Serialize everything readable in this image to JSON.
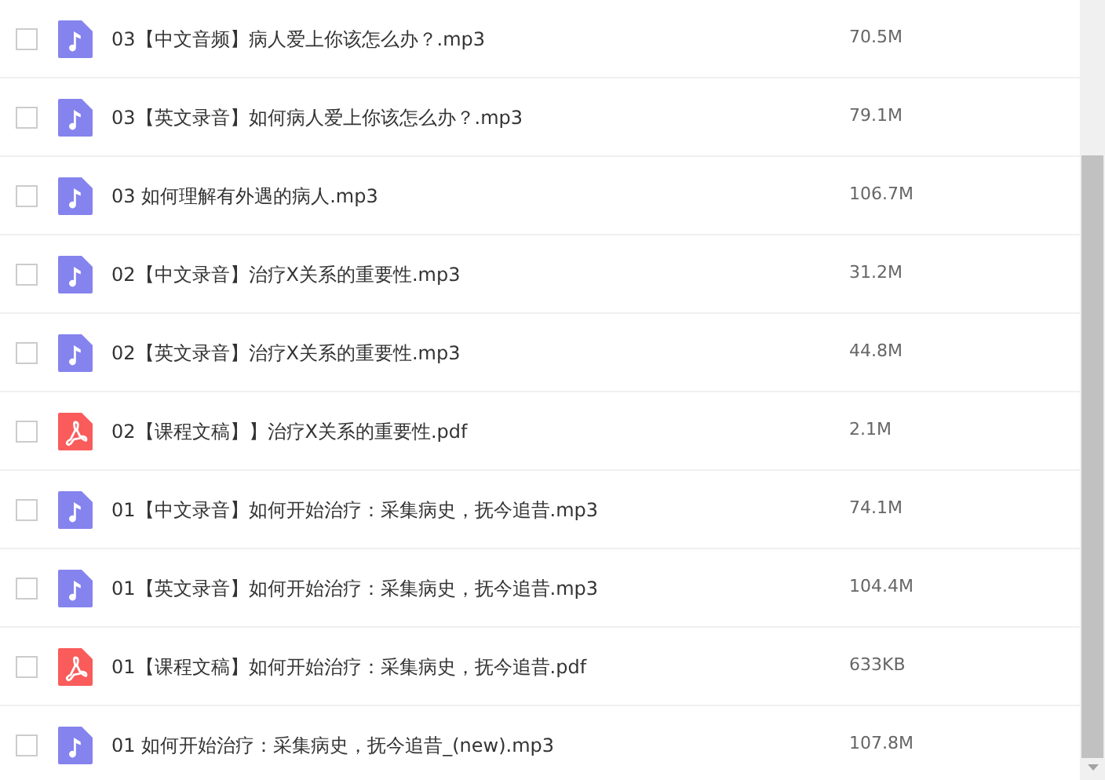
{
  "files": [
    {
      "kind": "audio",
      "name": "03【中文音频】病人爱上你该怎么办？.mp3",
      "size": "70.5M",
      "checked": false
    },
    {
      "kind": "audio",
      "name": "03【英文录音】如何病人爱上你该怎么办？.mp3",
      "size": "79.1M",
      "checked": false
    },
    {
      "kind": "audio",
      "name": "03 如何理解有外遇的病人.mp3",
      "size": "106.7M",
      "checked": false
    },
    {
      "kind": "audio",
      "name": "02【中文录音】治疗X关系的重要性.mp3",
      "size": "31.2M",
      "checked": false
    },
    {
      "kind": "audio",
      "name": "02【英文录音】治疗X关系的重要性.mp3",
      "size": "44.8M",
      "checked": false
    },
    {
      "kind": "pdf",
      "name": "02【课程文稿】】治疗X关系的重要性.pdf",
      "size": "2.1M",
      "checked": false
    },
    {
      "kind": "audio",
      "name": "01【中文录音】如何开始治疗：采集病史，抚今追昔.mp3",
      "size": "74.1M",
      "checked": false
    },
    {
      "kind": "audio",
      "name": "01【英文录音】如何开始治疗：采集病史，抚今追昔.mp3",
      "size": "104.4M",
      "checked": false
    },
    {
      "kind": "pdf",
      "name": "01【课程文稿】如何开始治疗：采集病史，抚今追昔.pdf",
      "size": "633KB",
      "checked": false
    },
    {
      "kind": "audio",
      "name": "01 如何开始治疗：采集病史，抚今追昔_(new).mp3",
      "size": "107.8M",
      "checked": false
    }
  ]
}
